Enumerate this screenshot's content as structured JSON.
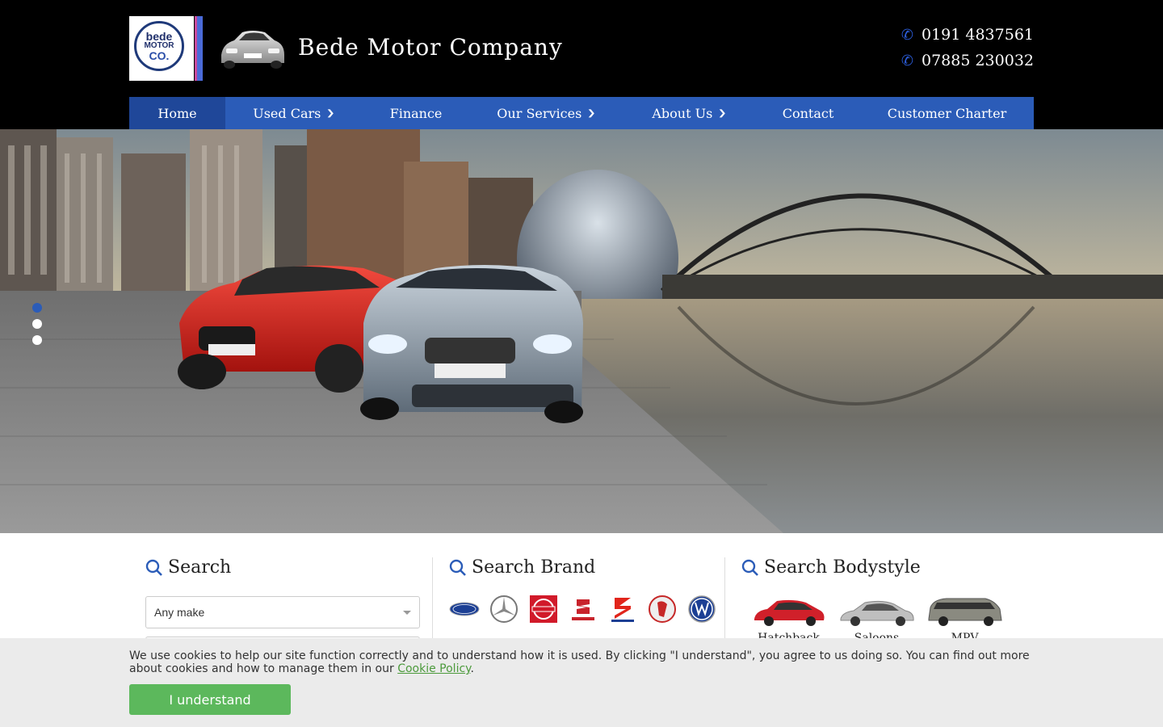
{
  "header": {
    "logo": {
      "line1": "bede",
      "line2": "MOTOR",
      "line3": "CO."
    },
    "brand_name": "Bede Motor Company",
    "phones": [
      "0191 4837561",
      "07885 230032"
    ]
  },
  "nav": {
    "items": [
      {
        "label": "Home",
        "active": true,
        "dropdown": false
      },
      {
        "label": "Used Cars",
        "active": false,
        "dropdown": true
      },
      {
        "label": "Finance",
        "active": false,
        "dropdown": false
      },
      {
        "label": "Our Services",
        "active": false,
        "dropdown": true
      },
      {
        "label": "About Us",
        "active": false,
        "dropdown": true
      },
      {
        "label": "Contact",
        "active": false,
        "dropdown": false
      },
      {
        "label": "Customer Charter",
        "active": false,
        "dropdown": false
      }
    ]
  },
  "hero": {
    "slide_count": 3,
    "active_slide": 1
  },
  "search": {
    "title": "Search",
    "make_select_value": "Any make"
  },
  "search_brand": {
    "title": "Search Brand",
    "brands": [
      "Ford",
      "Mercedes-Benz",
      "Nissan",
      "Seat",
      "Suzuki",
      "Vauxhall",
      "Volkswagen"
    ]
  },
  "search_bodystyle": {
    "title": "Search Bodystyle",
    "items": [
      "Hatchback",
      "Saloons",
      "MPV"
    ]
  },
  "cookie": {
    "text": "We use cookies to help our site function correctly and to understand how it is used. By clicking \"I understand\", you agree to us doing so. You can find out more about cookies and how to manage them in our ",
    "link_label": "Cookie Policy",
    "button_label": "I understand"
  },
  "colors": {
    "nav_bg": "#2b5cb8",
    "nav_active": "#1f4799",
    "accent_blue": "#2b5cd9",
    "cookie_button": "#5cb85c"
  },
  "icons": {
    "phone": "phone-icon",
    "search": "magnifier-icon",
    "dropdown": "chevron-down-icon"
  }
}
